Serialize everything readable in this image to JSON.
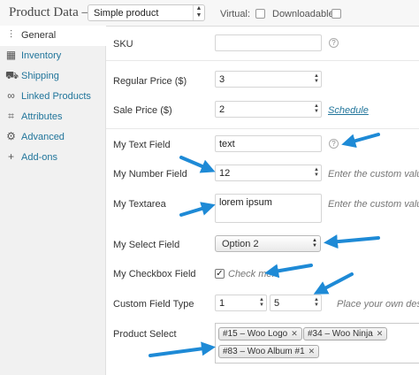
{
  "header": {
    "title": "Product Data —",
    "product_type": "Simple product",
    "virtual_label": "Virtual:",
    "downloadable_label": "Downloadable:"
  },
  "sidebar": {
    "items": [
      {
        "label": "General",
        "icon": "sliders-icon",
        "active": true
      },
      {
        "label": "Inventory",
        "icon": "boxes-icon"
      },
      {
        "label": "Shipping",
        "icon": "truck-icon"
      },
      {
        "label": "Linked Products",
        "icon": "link-icon"
      },
      {
        "label": "Attributes",
        "icon": "tag-icon"
      },
      {
        "label": "Advanced",
        "icon": "gear-icon"
      },
      {
        "label": "Add-ons",
        "icon": "plus-icon"
      }
    ]
  },
  "form": {
    "sku": {
      "label": "SKU",
      "value": ""
    },
    "regular_price": {
      "label": "Regular Price ($)",
      "value": "3"
    },
    "sale_price": {
      "label": "Sale Price ($)",
      "value": "2",
      "link": "Schedule"
    },
    "text_field": {
      "label": "My Text Field",
      "value": "text"
    },
    "number_field": {
      "label": "My Number Field",
      "value": "12",
      "description": "Enter the custom value h"
    },
    "textarea": {
      "label": "My Textarea",
      "value": "lorem ipsum",
      "description": "Enter the custom value h"
    },
    "select_field": {
      "label": "My Select Field",
      "value": "Option 2"
    },
    "checkbox_field": {
      "label": "My Checkbox Field",
      "text": "Check me!",
      "checked": true
    },
    "custom_field_type": {
      "label": "Custom Field Type",
      "value1": "1",
      "value2": "5",
      "description": "Place your own descri"
    },
    "product_select": {
      "label": "Product Select",
      "chips": [
        "#15 – Woo Logo",
        "#34 – Woo Ninja",
        "#83 – Woo Album #1"
      ]
    }
  },
  "colors": {
    "accent_link": "#21759b",
    "arrow": "#1e8ad6"
  }
}
